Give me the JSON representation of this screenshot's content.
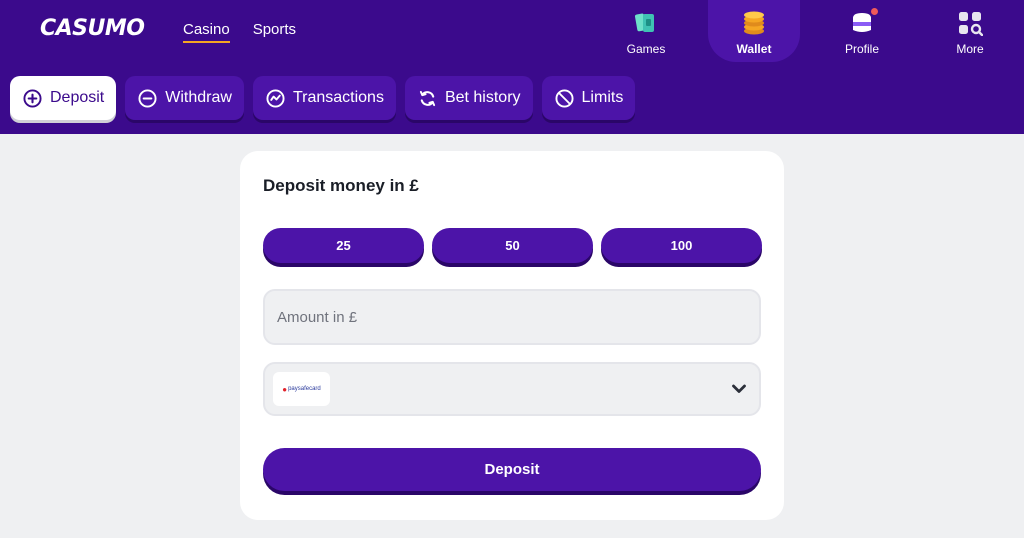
{
  "brand": {
    "logo_text": "CASUMO"
  },
  "main_nav": {
    "casino": "Casino",
    "sports": "Sports"
  },
  "right_nav": {
    "games": "Games",
    "wallet": "Wallet",
    "profile": "Profile",
    "more": "More"
  },
  "wallet_tabs": {
    "deposit": "Deposit",
    "withdraw": "Withdraw",
    "transactions": "Transactions",
    "bet_history": "Bet history",
    "limits": "Limits"
  },
  "deposit_form": {
    "title": "Deposit money in £",
    "quick_amounts": [
      "25",
      "50",
      "100"
    ],
    "amount_placeholder": "Amount in £",
    "payment_method": {
      "logo_mark": "●",
      "logo_text": "paysafecard"
    },
    "submit_label": "Deposit"
  },
  "colors": {
    "brand_purple": "#3b0a8c",
    "button_purple": "#4c14a8",
    "accent_underline": "#f5a623",
    "notification_dot": "#ef5a5a"
  },
  "icons": [
    "games-icon",
    "wallet-coins-icon",
    "profile-icon",
    "more-grid-icon",
    "plus-circle-icon",
    "minus-circle-icon",
    "transactions-icon",
    "refresh-icon",
    "limits-icon",
    "chevron-down-icon"
  ]
}
